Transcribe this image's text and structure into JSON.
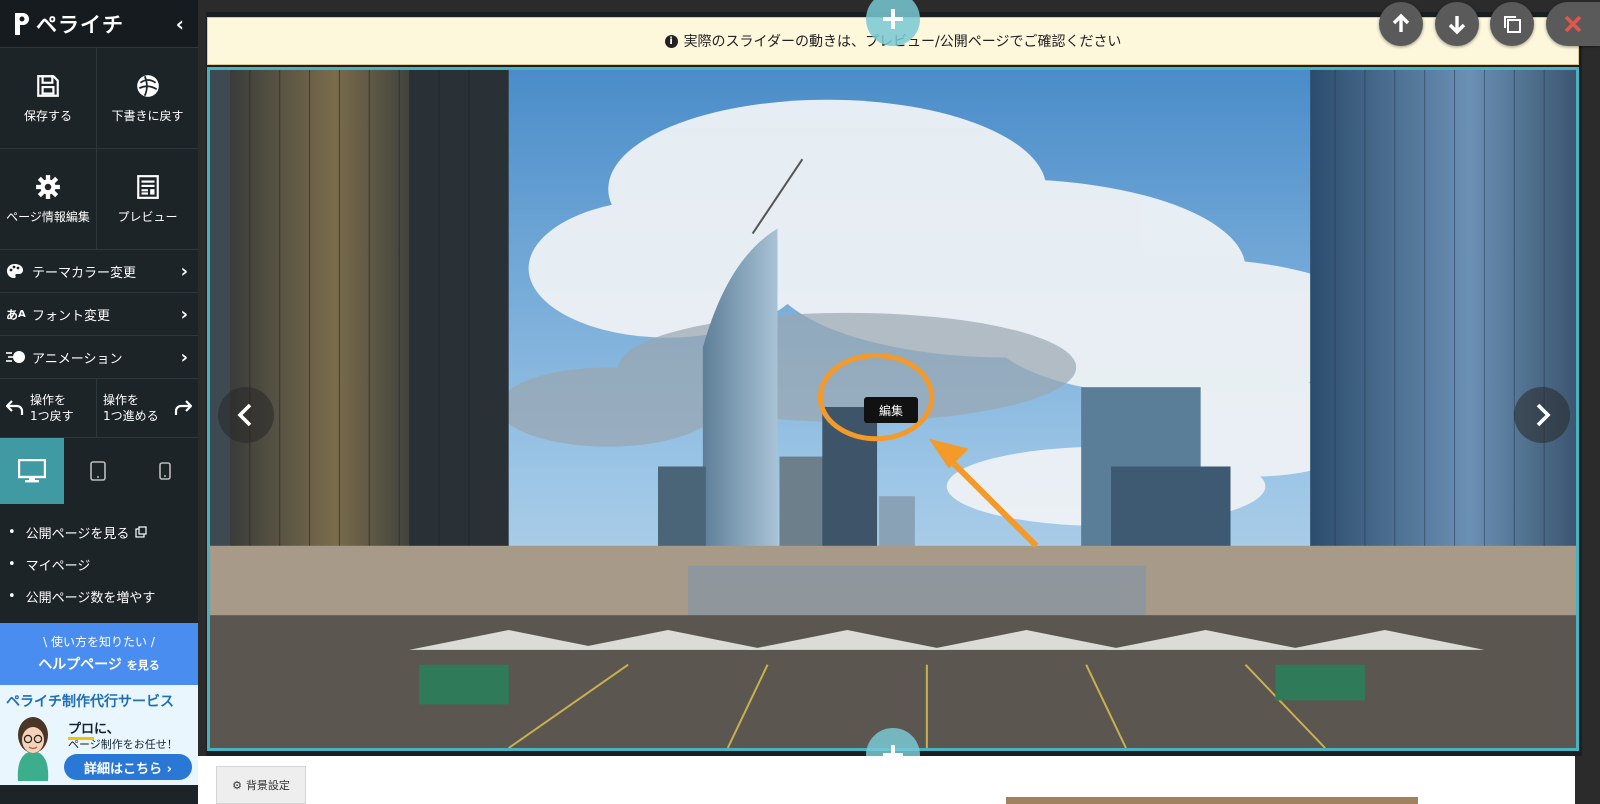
{
  "brand": {
    "name": "ペライチ"
  },
  "sidebar": {
    "tiles": [
      {
        "label": "保存する",
        "icon": "save-icon"
      },
      {
        "label": "下書きに戻す",
        "icon": "revert-draft-icon"
      },
      {
        "label": "ページ情報編集",
        "icon": "gear-icon"
      },
      {
        "label": "プレビュー",
        "icon": "preview-icon"
      }
    ],
    "menu": [
      {
        "label": "テーマカラー変更",
        "icon": "palette-icon"
      },
      {
        "label": "フォント変更",
        "icon": "font-icon"
      },
      {
        "label": "アニメーション",
        "icon": "animation-icon"
      }
    ],
    "undo": {
      "line1": "操作を",
      "line2": "1つ戻す"
    },
    "redo": {
      "line1": "操作を",
      "line2": "1つ進める"
    },
    "devices": [
      {
        "name": "desktop",
        "active": true
      },
      {
        "name": "tablet",
        "active": false
      },
      {
        "name": "mobile",
        "active": false
      }
    ],
    "links": [
      "公開ページを見る",
      "マイページ",
      "公開ページ数を増やす"
    ],
    "help": {
      "sub": "\\ 使い方を知りたい /",
      "main": "ヘルプページ",
      "suffix": "を見る"
    },
    "ad": {
      "title": "ペライチ制作代行サービス",
      "line1_em": "プロ",
      "line1_rest": "に、",
      "line2": "ページ制作をお任せ！",
      "button": "詳細はこちら ›"
    }
  },
  "editor": {
    "notice": "実際のスライダーの動きは、プレビュー/公開ページでご確認ください",
    "edit_chip": "編集",
    "background_button": "背景設定",
    "annotation_color": "#f39a2a",
    "accent_color": "#46b3c1"
  }
}
